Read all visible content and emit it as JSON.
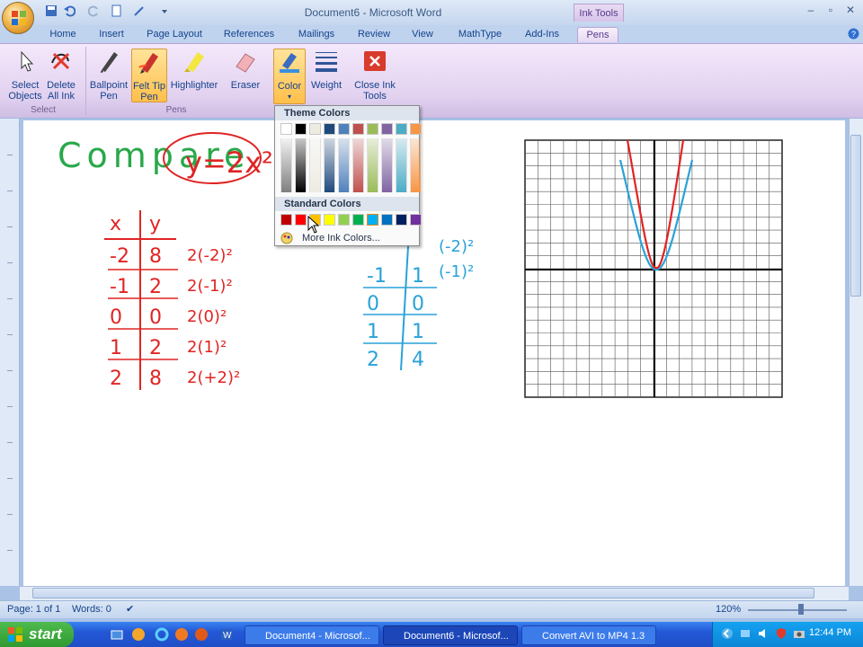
{
  "window": {
    "title": "Document6 - Microsoft Word",
    "contextual_tab_group": "Ink Tools"
  },
  "tabs": [
    {
      "label": "Home"
    },
    {
      "label": "Insert"
    },
    {
      "label": "Page Layout"
    },
    {
      "label": "References"
    },
    {
      "label": "Mailings"
    },
    {
      "label": "Review"
    },
    {
      "label": "View"
    },
    {
      "label": "MathType"
    },
    {
      "label": "Add-Ins"
    },
    {
      "label": "Pens",
      "active": true
    }
  ],
  "ribbon": {
    "select_objects": "Select Objects",
    "delete_all_ink": "Delete All Ink",
    "ballpoint_pen": "Ballpoint Pen",
    "felt_tip_pen": "Felt Tip Pen",
    "highlighter": "Highlighter",
    "eraser": "Eraser",
    "color": "Color",
    "weight": "Weight",
    "close_ink_tools": "Close Ink Tools",
    "group_select": "Select",
    "group_pens": "Pens"
  },
  "color_popup": {
    "theme_header": "Theme Colors",
    "standard_header": "Standard Colors",
    "more_link": "More Ink Colors...",
    "theme_colors": [
      "#ffffff",
      "#000000",
      "#eeece1",
      "#1f497d",
      "#4f81bd",
      "#c0504d",
      "#9bbb59",
      "#8064a2",
      "#4bacc6",
      "#f79646"
    ],
    "standard_colors": [
      "#c00000",
      "#ff0000",
      "#ffc000",
      "#ffff00",
      "#92d050",
      "#00b050",
      "#00b0f0",
      "#0070c0",
      "#002060",
      "#7030a0"
    ]
  },
  "document": {
    "heading_word": "Compare",
    "red_function": "y=2x²",
    "red_table": {
      "headers": [
        "x",
        "y"
      ],
      "x": [
        "-2",
        "-1",
        "0",
        "1",
        "2"
      ],
      "y": [
        "8",
        "2",
        "0",
        "2",
        "8"
      ],
      "work": [
        "2(-2)²",
        "2(-1)²",
        "2(0)²",
        "2(1)²",
        "2(+2)²"
      ]
    },
    "blue_table": {
      "x": [
        "-1",
        "0",
        "1",
        "2"
      ],
      "y": [
        "1",
        "0",
        "1",
        "4"
      ],
      "work": [
        "(-2)²",
        "(-1)²"
      ]
    }
  },
  "status": {
    "page": "Page: 1 of 1",
    "words": "Words: 0",
    "zoom": "120%"
  },
  "taskbar": {
    "start": "start",
    "items": [
      {
        "label": "Document4 - Microsof..."
      },
      {
        "label": "Document6 - Microsof...",
        "active": true
      },
      {
        "label": "Convert AVI to MP4 1.3"
      }
    ],
    "clock": "12:44 PM"
  }
}
